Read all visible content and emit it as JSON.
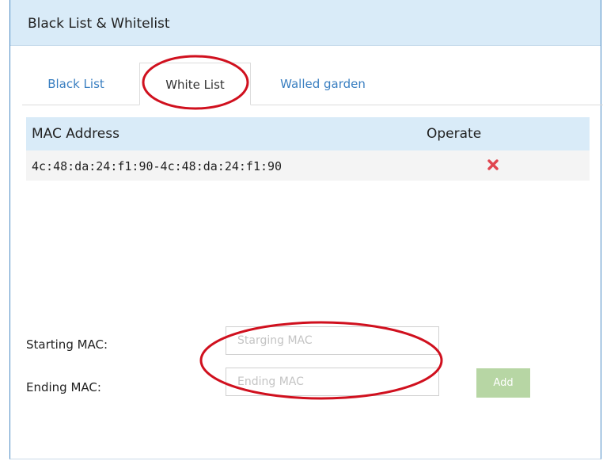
{
  "panel": {
    "title": "Black List & Whitelist"
  },
  "tabs": [
    {
      "label": "Black List",
      "active": false
    },
    {
      "label": "White List",
      "active": true
    },
    {
      "label": "Walled garden",
      "active": false
    }
  ],
  "table": {
    "columns": [
      "MAC Address",
      "Operate"
    ],
    "rows": [
      {
        "mac": "4c:48:da:24:f1:90-4c:48:da:24:f1:90",
        "operate_icon": "delete-x-icon"
      }
    ]
  },
  "form": {
    "starting_label": "Starting MAC:",
    "starting_placeholder": "Starging MAC",
    "starting_value": "",
    "ending_label": "Ending MAC:",
    "ending_placeholder": "Ending MAC",
    "ending_value": "",
    "add_label": "Add"
  },
  "colors": {
    "header_bg": "#d9ebf8",
    "tab_link": "#3a7fc1",
    "delete_icon": "#e0454f",
    "add_button": "#b7d6a4",
    "annotation": "#d0101e"
  }
}
